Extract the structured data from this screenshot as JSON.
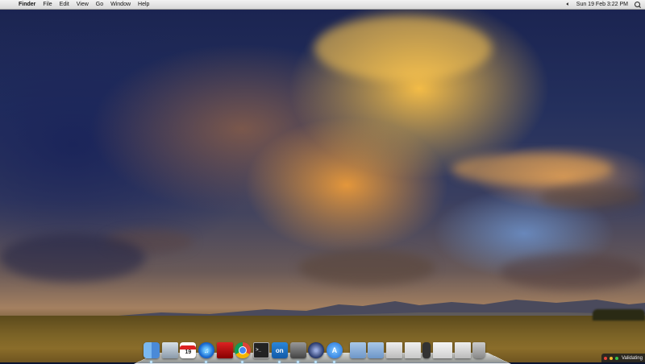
{
  "menubar": {
    "app_name": "Finder",
    "items": [
      "File",
      "Edit",
      "View",
      "Go",
      "Window",
      "Help"
    ],
    "datetime": "Sun 19 Feb  3:22 PM",
    "volume_icon": "speaker-icon",
    "search_icon": "spotlight-icon"
  },
  "dock": {
    "calendar_day": "19",
    "terminal_glyph": ">_",
    "on_label": "on",
    "appstore_glyph": "A",
    "icons": [
      "finder-icon",
      "mail-icon",
      "calendar-icon",
      "itunes-icon",
      "red-book-icon",
      "chrome-icon",
      "terminal-icon",
      "on-app-icon",
      "hard-drive-icon",
      "globe-icon",
      "app-store-icon",
      "applications-folder-icon",
      "documents-folder-icon",
      "document-stack-icon",
      "downloads-stack-icon",
      "dark-stack-icon",
      "window-stack-icon",
      "screenshot-stack-icon",
      "trash-icon"
    ]
  },
  "status_widget": {
    "label": "Validating",
    "colors": [
      "#e8443a",
      "#f5b62c",
      "#3ac24a"
    ]
  }
}
